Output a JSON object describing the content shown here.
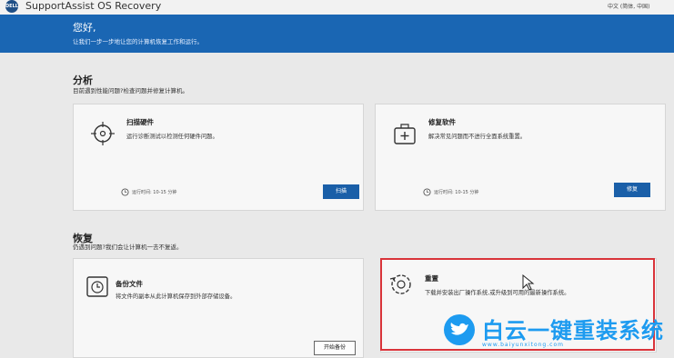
{
  "app": {
    "logo": "DELL",
    "title": "SupportAssist OS Recovery",
    "language": "中文 (简体, 中国)"
  },
  "hero": {
    "greeting": "您好,",
    "subtitle": "让我们一步一步地让您的计算机恢复工作和运行。"
  },
  "analyze": {
    "title": "分析",
    "subtitle": "目前遇到性能问题?检查问题并修复计算机。",
    "cards": [
      {
        "title": "扫描硬件",
        "desc": "运行诊断测试以检测任何硬件问题。",
        "time": "运行时间: 10-15 分钟",
        "button": "扫描",
        "icon": "crosshair-icon"
      },
      {
        "title": "修复软件",
        "desc": "解决常见问题而不进行全面系统重置。",
        "time": "运行时间: 10-15 分钟",
        "button": "修复",
        "icon": "toolbox-icon"
      }
    ]
  },
  "recover": {
    "title": "恢复",
    "subtitle": "仍遇到问题?我们会让计算机一去不复返。",
    "cards": [
      {
        "title": "备份文件",
        "desc": "将文件的副本从此计算机保存到外部存储设备。",
        "button": "开始备份",
        "icon": "clock-backup-icon"
      },
      {
        "title": "重置",
        "desc": "下载并安装出厂操作系统,或升级到可用的最新操作系统。",
        "icon": "gear-reset-icon"
      }
    ]
  },
  "watermark": {
    "text": "白云一键重装系统",
    "url": "www.baiyunxitong.com"
  },
  "colors": {
    "brand_blue": "#1a66b3",
    "button_blue": "#1a5fa8",
    "highlight_red": "#d9343a"
  }
}
